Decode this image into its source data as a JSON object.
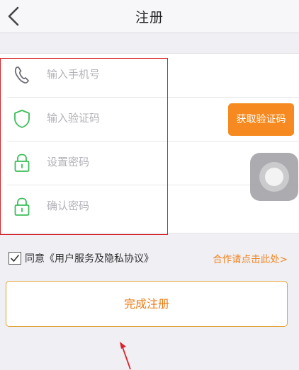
{
  "nav": {
    "title": "注册"
  },
  "form": {
    "fields": [
      {
        "placeholder": "输入手机号",
        "icon": "phone-icon"
      },
      {
        "placeholder": "输入验证码",
        "icon": "shield-icon"
      },
      {
        "placeholder": "设置密码",
        "icon": "lock-icon"
      },
      {
        "placeholder": "确认密码",
        "icon": "lock-icon"
      }
    ],
    "code_button": "获取验证码"
  },
  "agreement": {
    "checked": true,
    "text": "同意《用户服务及隐私协议》"
  },
  "cooperation_link": "合作请点击此处>",
  "submit_label": "完成注册",
  "colors": {
    "accent": "#f6891f",
    "icon_green": "#3dbd5a",
    "annotation_red": "#d7232b"
  }
}
